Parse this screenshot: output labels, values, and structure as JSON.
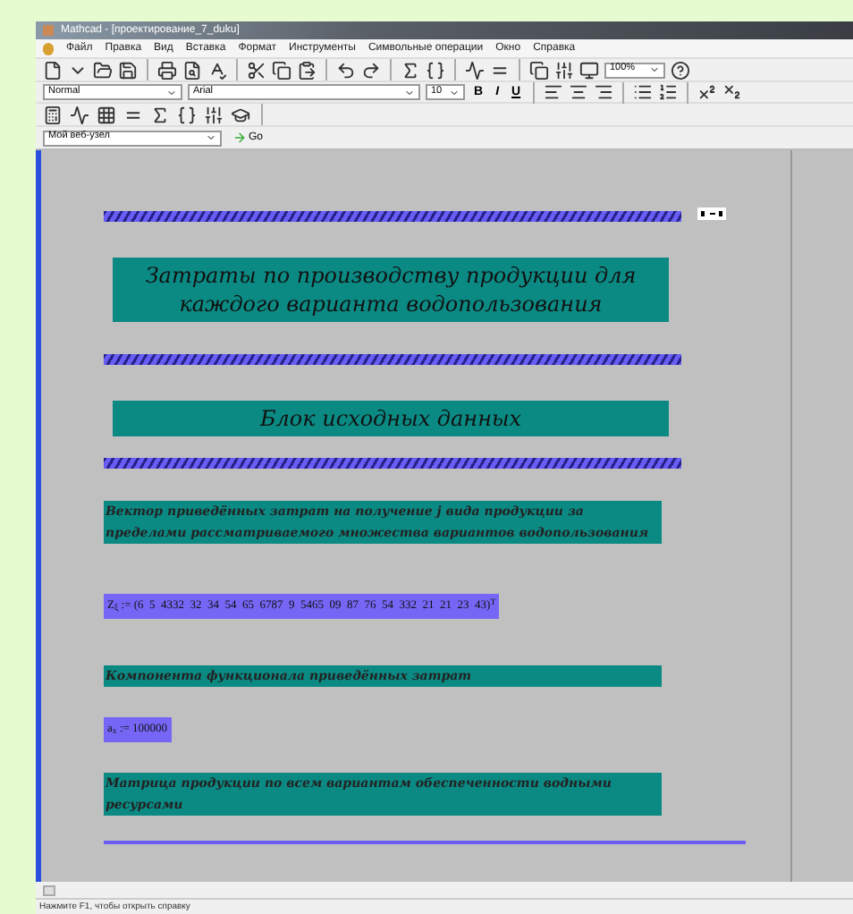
{
  "window": {
    "title": "Mathcad - [проектирование_7_duku]"
  },
  "menu": [
    "Файл",
    "Правка",
    "Вид",
    "Вставка",
    "Формат",
    "Инструменты",
    "Символьные операции",
    "Окно",
    "Справка"
  ],
  "standard_toolbar": {
    "zoom": "100%"
  },
  "formatting_toolbar": {
    "style": "Normal",
    "font": "Arial",
    "size": "10",
    "bold": "B",
    "italic": "I",
    "underline": "U"
  },
  "web_toolbar": {
    "address": "Мой веб-узел",
    "go": "Go"
  },
  "document": {
    "blocks": [
      {
        "kind": "divider"
      },
      {
        "kind": "heading",
        "text": "Затраты по производству продукции для каждого варианта водопользования"
      },
      {
        "kind": "divider"
      },
      {
        "kind": "heading",
        "text": "Блок исходных данных"
      },
      {
        "kind": "divider"
      },
      {
        "kind": "note",
        "text": "Вектор приведённых затрат на получение j вида продукции за пределами рассматриваемого множества вариантов водопользования"
      },
      {
        "kind": "math",
        "text": "Z$_{ξ}$ := (6  5  4332  32  34  54  65  6787  9  5465  09  87  76  54  332  21  21  23  43)$^{T}$"
      },
      {
        "kind": "note",
        "text": "Компонента функционала приведённых затрат"
      },
      {
        "kind": "math",
        "text": "a$_{x}$ := 100000"
      },
      {
        "kind": "note",
        "text": "Матрица продукции по всем вариантам обеспеченности водными ресурсами"
      },
      {
        "kind": "rule"
      }
    ]
  },
  "status_bar": "Нажмите F1, чтобы открыть справку"
}
